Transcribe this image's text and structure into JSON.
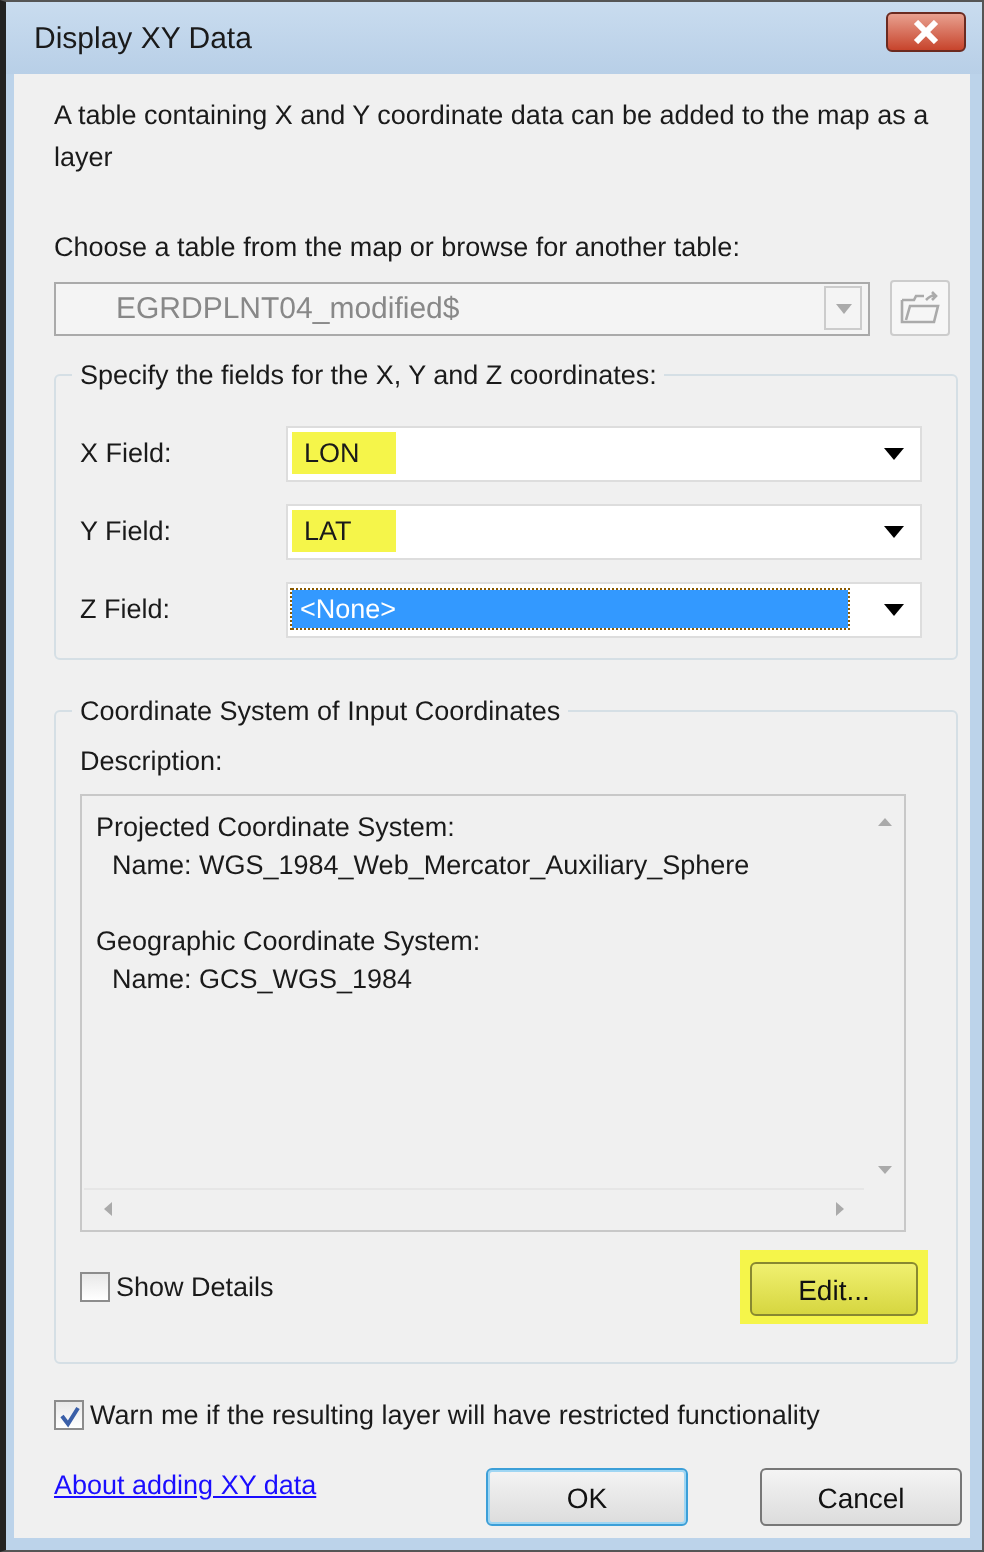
{
  "window": {
    "title": "Display XY Data"
  },
  "intro": "A table containing X and Y coordinate data can be added to the map as a layer",
  "table_prompt": "Choose a table from the map or browse for another table:",
  "table_combo": {
    "value": "EGRDPLNT04_modified$",
    "disabled": true
  },
  "fields_group": {
    "legend": "Specify the fields for the X, Y and Z coordinates:",
    "fields": [
      {
        "label": "X Field:",
        "value": "LON",
        "highlighted": true,
        "selected": false
      },
      {
        "label": "Y Field:",
        "value": "LAT",
        "highlighted": true,
        "selected": false
      },
      {
        "label": "Z Field:",
        "value": "<None>",
        "highlighted": false,
        "selected": true
      }
    ]
  },
  "coord_group": {
    "legend": "Coordinate System of Input Coordinates",
    "description_label": "Description:",
    "description_sections": [
      {
        "heading": "Projected Coordinate System:",
        "name": "Name: WGS_1984_Web_Mercator_Auxiliary_Sphere"
      },
      {
        "heading": "Geographic Coordinate System:",
        "name": "Name: GCS_WGS_1984"
      }
    ],
    "show_details": {
      "label": "Show Details",
      "checked": false
    },
    "edit_button": {
      "label": "Edit...",
      "highlighted": true
    }
  },
  "warn": {
    "label": "Warn me if the resulting layer will have restricted functionality",
    "checked": true
  },
  "help_link": "About adding XY data",
  "buttons": [
    {
      "label": "OK",
      "default": true
    },
    {
      "label": "Cancel",
      "default": false
    }
  ]
}
